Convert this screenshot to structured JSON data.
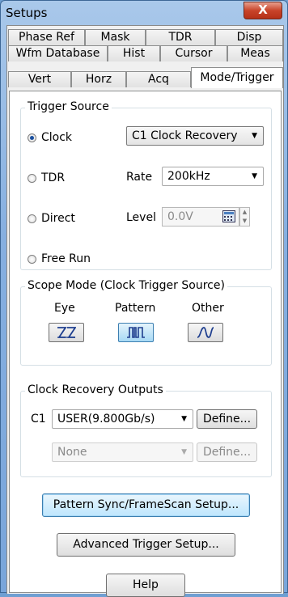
{
  "window": {
    "title": "Setups",
    "close_glyph": "X"
  },
  "tabs": {
    "row1": [
      "Phase Ref",
      "Mask",
      "TDR",
      "Disp"
    ],
    "row2": [
      "Wfm Database",
      "Hist",
      "Cursor",
      "Meas"
    ],
    "row3": [
      "Vert",
      "Horz",
      "Acq",
      "Mode/Trigger"
    ],
    "active": "Mode/Trigger"
  },
  "trigger_source": {
    "title": "Trigger Source",
    "options": [
      "Clock",
      "TDR",
      "Direct",
      "Free Run"
    ],
    "selected": "Clock",
    "clock_combo_value": "C1 Clock Recovery",
    "rate_label": "Rate",
    "rate_value": "200kHz",
    "level_label": "Level",
    "level_value": "0.0V"
  },
  "scope_mode": {
    "title": "Scope Mode (Clock Trigger Source)",
    "modes": [
      "Eye",
      "Pattern",
      "Other"
    ],
    "active": "Pattern"
  },
  "clock_recovery": {
    "title": "Clock Recovery Outputs",
    "row_label": "C1",
    "output1_value": "USER(9.800Gb/s)",
    "output2_value": "None",
    "define_label": "Define..."
  },
  "buttons": {
    "pattern_sync": "Pattern Sync/FrameScan Setup...",
    "advanced_trigger": "Advanced Trigger Setup...",
    "help": "Help"
  }
}
